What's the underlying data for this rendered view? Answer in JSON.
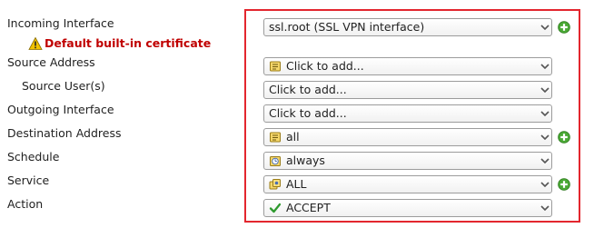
{
  "form": {
    "labels": {
      "incoming": "Incoming Interface",
      "source_address": "Source Address",
      "source_users": "Source User(s)",
      "outgoing": "Outgoing Interface",
      "destination": "Destination Address",
      "schedule": "Schedule",
      "service": "Service",
      "action": "Action"
    },
    "warning": {
      "text": "Default built-in certificate",
      "icon": "warning-icon",
      "color": "#c00000"
    },
    "fields": {
      "incoming": {
        "value": "ssl.root (SSL VPN interface)"
      },
      "source_address": {
        "value": "Click to add...",
        "icon": "address-icon"
      },
      "source_users": {
        "value": "Click to add..."
      },
      "outgoing": {
        "value": "Click to add..."
      },
      "destination": {
        "value": "all",
        "icon": "address-icon"
      },
      "schedule": {
        "value": "always",
        "icon": "schedule-icon"
      },
      "service": {
        "value": "ALL",
        "icon": "service-group-icon"
      },
      "action": {
        "value": "ACCEPT",
        "icon": "checkmark-icon"
      }
    },
    "highlight_color": "#e3262e",
    "add_button_color": "#3f9e2c"
  }
}
